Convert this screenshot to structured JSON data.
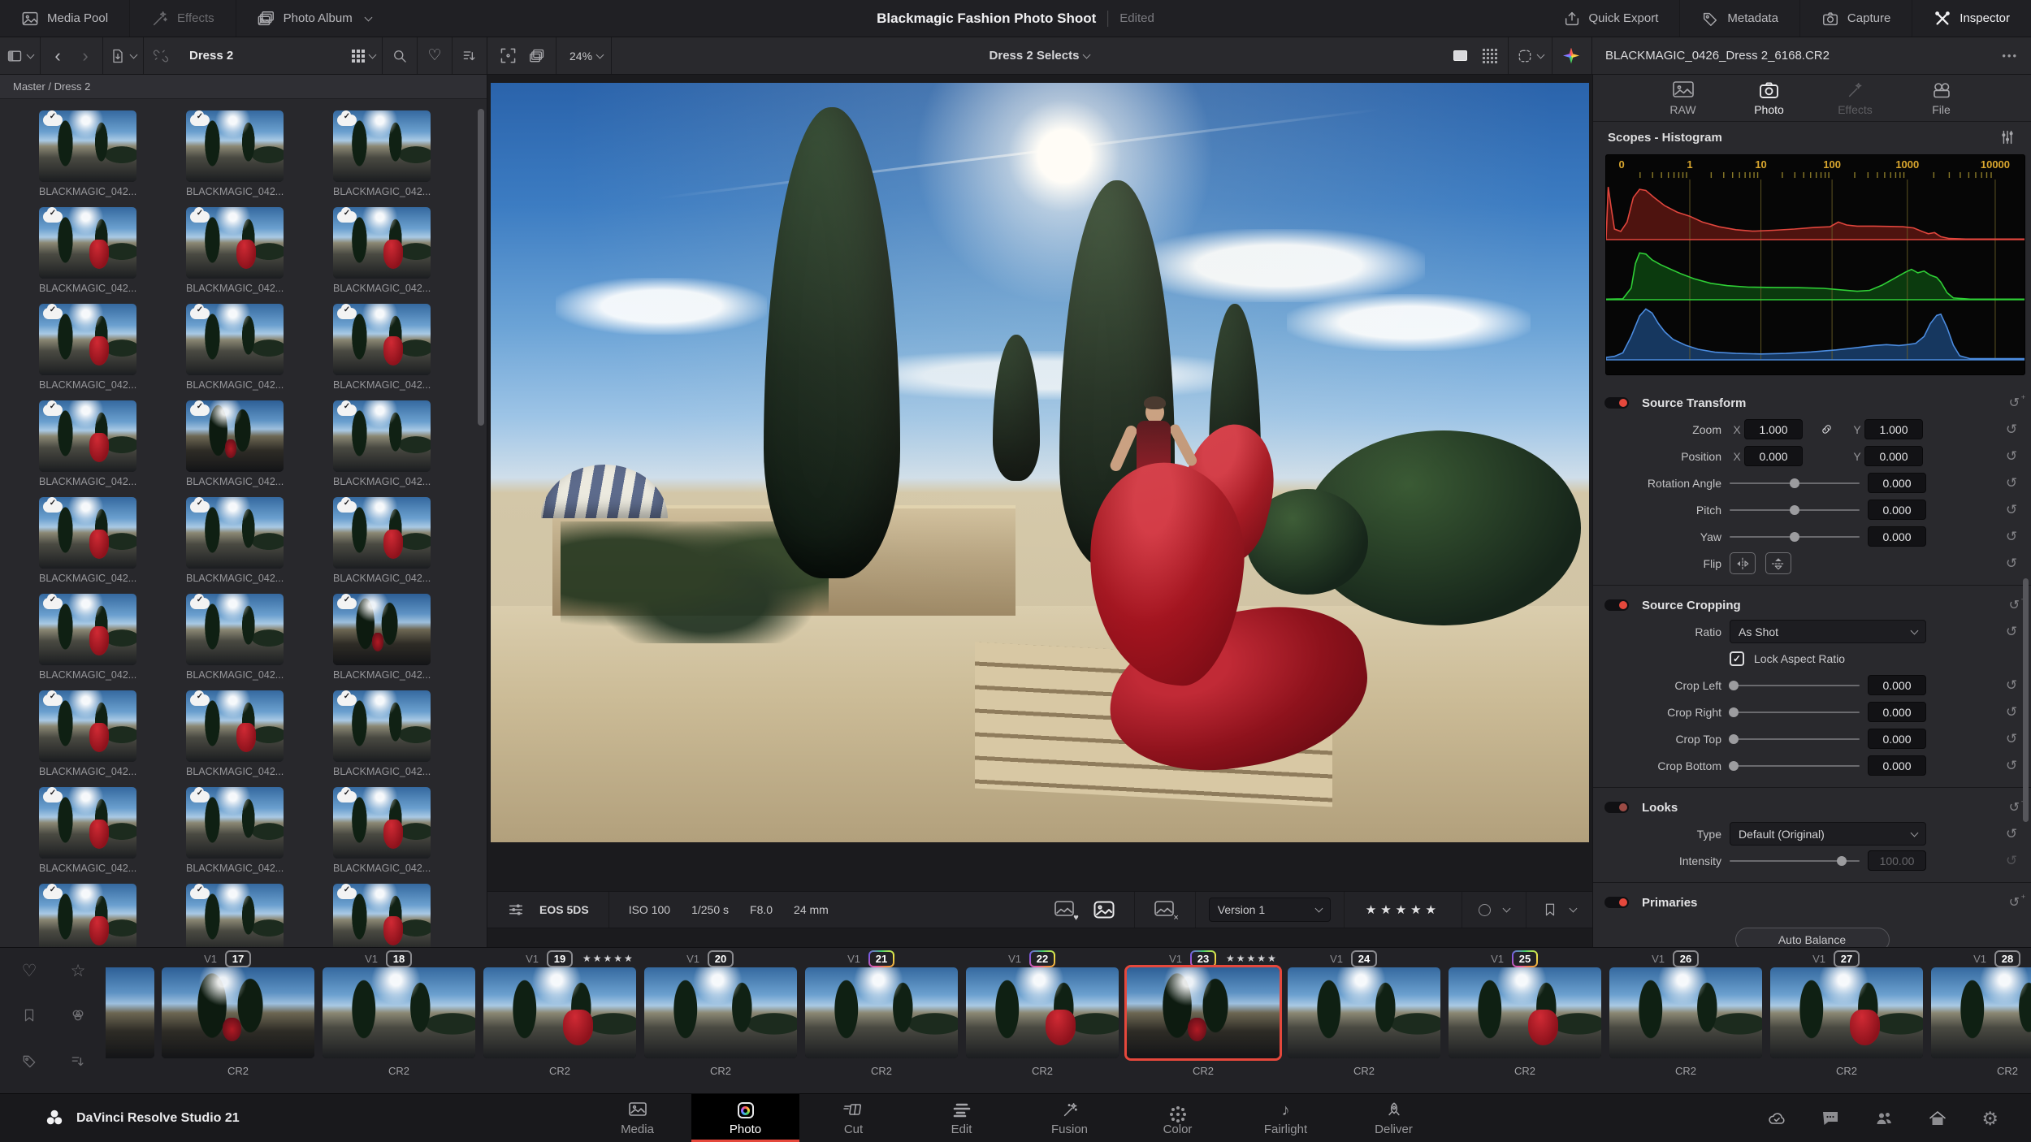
{
  "colors": {
    "accent": "#e5483c"
  },
  "icons": {
    "check": "✓",
    "reset": "↺",
    "plus": "+",
    "menu": "•••",
    "back": "‹",
    "forward": "›",
    "heart": "♡",
    "star": "☆",
    "note": "♪",
    "gear": "⚙",
    "heart_small": "♥",
    "x_small": "×"
  },
  "topbar": {
    "media_pool": "Media Pool",
    "effects": "Effects",
    "photo_album": "Photo Album",
    "title": "Blackmagic Fashion Photo Shoot",
    "edited": "Edited",
    "quick_export": "Quick Export",
    "metadata": "Metadata",
    "capture": "Capture",
    "inspector": "Inspector"
  },
  "browser": {
    "album_label": "Dress 2",
    "zoom_level": "24%",
    "breadcrumb": "Master / Dress 2",
    "items": [
      {
        "label": "BLACKMAGIC_042...",
        "variant": "a"
      },
      {
        "label": "BLACKMAGIC_042...",
        "variant": "a"
      },
      {
        "label": "BLACKMAGIC_042...",
        "variant": "a"
      },
      {
        "label": "BLACKMAGIC_042...",
        "variant": "b"
      },
      {
        "label": "BLACKMAGIC_042...",
        "variant": "b"
      },
      {
        "label": "BLACKMAGIC_042...",
        "variant": "b"
      },
      {
        "label": "BLACKMAGIC_042...",
        "variant": "b"
      },
      {
        "label": "BLACKMAGIC_042...",
        "variant": "a"
      },
      {
        "label": "BLACKMAGIC_042...",
        "variant": "b"
      },
      {
        "label": "BLACKMAGIC_042...",
        "variant": "b"
      },
      {
        "label": "BLACKMAGIC_042...",
        "variant": "c"
      },
      {
        "label": "BLACKMAGIC_042...",
        "variant": "a"
      },
      {
        "label": "BLACKMAGIC_042...",
        "variant": "b"
      },
      {
        "label": "BLACKMAGIC_042...",
        "variant": "a"
      },
      {
        "label": "BLACKMAGIC_042...",
        "variant": "b"
      },
      {
        "label": "BLACKMAGIC_042...",
        "variant": "b"
      },
      {
        "label": "BLACKMAGIC_042...",
        "variant": "a"
      },
      {
        "label": "BLACKMAGIC_042...",
        "variant": "c"
      },
      {
        "label": "BLACKMAGIC_042...",
        "variant": "b"
      },
      {
        "label": "BLACKMAGIC_042...",
        "variant": "b"
      },
      {
        "label": "BLACKMAGIC_042...",
        "variant": "a"
      },
      {
        "label": "BLACKMAGIC_042...",
        "variant": "b"
      },
      {
        "label": "BLACKMAGIC_042...",
        "variant": "a"
      },
      {
        "label": "BLACKMAGIC_042...",
        "variant": "b"
      },
      {
        "label": "BLACKMAGIC_042...",
        "variant": "b"
      },
      {
        "label": "BLACKMAGIC_042...",
        "variant": "a"
      },
      {
        "label": "BLACKMAGIC_042...",
        "variant": "b"
      }
    ]
  },
  "viewer": {
    "collection_label": "Dress 2 Selects"
  },
  "metadata_bar": {
    "camera": "EOS 5DS",
    "iso": "ISO 100",
    "shutter": "1/250 s",
    "aperture": "F8.0",
    "focal": "24 mm",
    "version": "Version 1",
    "rating": "★★★★★"
  },
  "inspector": {
    "filename": "BLACKMAGIC_0426_Dress 2_6168.CR2",
    "tabs": [
      {
        "label": "RAW"
      },
      {
        "label": "Photo"
      },
      {
        "label": "Effects"
      },
      {
        "label": "File"
      }
    ],
    "scopes_title": "Scopes - Histogram",
    "source_transform": {
      "title": "Source Transform",
      "zoom_label": "Zoom",
      "position_label": "Position",
      "x_label": "X",
      "y_label": "Y",
      "zoom_x": "1.000",
      "zoom_y": "1.000",
      "position_x": "0.000",
      "position_y": "0.000",
      "sliders": [
        {
          "label": "Rotation Angle",
          "value": "0.000"
        },
        {
          "label": "Pitch",
          "value": "0.000"
        },
        {
          "label": "Yaw",
          "value": "0.000"
        }
      ],
      "flip_label": "Flip"
    },
    "source_cropping": {
      "title": "Source Cropping",
      "ratio_label": "Ratio",
      "ratio_value": "As Shot",
      "lock_label": "Lock Aspect Ratio",
      "sliders": [
        {
          "label": "Crop Left",
          "value": "0.000"
        },
        {
          "label": "Crop Right",
          "value": "0.000"
        },
        {
          "label": "Crop Top",
          "value": "0.000"
        },
        {
          "label": "Crop Bottom",
          "value": "0.000"
        }
      ]
    },
    "looks": {
      "title": "Looks",
      "type_label": "Type",
      "type_value": "Default (Original)",
      "intensity_label": "Intensity",
      "intensity_value": "100.00"
    },
    "primaries": {
      "title": "Primaries",
      "auto_balance": "Auto Balance"
    }
  },
  "chart_data": {
    "type": "histogram",
    "title": "Scopes - Histogram",
    "scale": "log",
    "legend": "none",
    "grid": true,
    "axis": {
      "labels": [
        "0",
        "1",
        "10",
        "100",
        "1000",
        "10000"
      ],
      "x": [
        0.03,
        0.2,
        0.37,
        0.54,
        0.72,
        0.93
      ],
      "color": "#d9a62e",
      "tick_color": "#8a7a28",
      "grid_color": "#6d6128"
    },
    "series": [
      {
        "name": "red",
        "stroke": "#e0463d",
        "fill": "#4e130f",
        "points": [
          [
            0,
            0.02
          ],
          [
            0.005,
            0.9
          ],
          [
            0.012,
            0.55
          ],
          [
            0.02,
            0.18
          ],
          [
            0.035,
            0.14
          ],
          [
            0.05,
            0.3
          ],
          [
            0.065,
            0.72
          ],
          [
            0.08,
            0.86
          ],
          [
            0.095,
            0.84
          ],
          [
            0.115,
            0.72
          ],
          [
            0.14,
            0.58
          ],
          [
            0.17,
            0.47
          ],
          [
            0.2,
            0.4
          ],
          [
            0.23,
            0.3
          ],
          [
            0.27,
            0.22
          ],
          [
            0.31,
            0.17
          ],
          [
            0.35,
            0.145
          ],
          [
            0.4,
            0.16
          ],
          [
            0.45,
            0.18
          ],
          [
            0.5,
            0.21
          ],
          [
            0.535,
            0.22
          ],
          [
            0.555,
            0.3
          ],
          [
            0.575,
            0.25
          ],
          [
            0.6,
            0.23
          ],
          [
            0.64,
            0.23
          ],
          [
            0.68,
            0.225
          ],
          [
            0.71,
            0.22
          ],
          [
            0.735,
            0.2
          ],
          [
            0.755,
            0.14
          ],
          [
            0.77,
            0.1
          ],
          [
            0.785,
            0.12
          ],
          [
            0.8,
            0.05
          ],
          [
            0.82,
            0.02
          ],
          [
            0.86,
            0.01
          ],
          [
            1,
            0.01
          ]
        ]
      },
      {
        "name": "green",
        "stroke": "#2fcf36",
        "fill": "#0b3a0e",
        "points": [
          [
            0,
            0.01
          ],
          [
            0.04,
            0.015
          ],
          [
            0.06,
            0.2
          ],
          [
            0.07,
            0.62
          ],
          [
            0.08,
            0.8
          ],
          [
            0.095,
            0.78
          ],
          [
            0.11,
            0.68
          ],
          [
            0.13,
            0.6
          ],
          [
            0.155,
            0.52
          ],
          [
            0.18,
            0.44
          ],
          [
            0.21,
            0.36
          ],
          [
            0.25,
            0.28
          ],
          [
            0.29,
            0.24
          ],
          [
            0.34,
            0.215
          ],
          [
            0.4,
            0.21
          ],
          [
            0.46,
            0.205
          ],
          [
            0.52,
            0.195
          ],
          [
            0.56,
            0.17
          ],
          [
            0.6,
            0.145
          ],
          [
            0.63,
            0.16
          ],
          [
            0.66,
            0.25
          ],
          [
            0.69,
            0.37
          ],
          [
            0.715,
            0.47
          ],
          [
            0.73,
            0.52
          ],
          [
            0.745,
            0.46
          ],
          [
            0.76,
            0.49
          ],
          [
            0.775,
            0.42
          ],
          [
            0.79,
            0.38
          ],
          [
            0.8,
            0.3
          ],
          [
            0.815,
            0.12
          ],
          [
            0.83,
            0.03
          ],
          [
            0.87,
            0.01
          ],
          [
            1,
            0.01
          ]
        ]
      },
      {
        "name": "blue",
        "stroke": "#4b8bde",
        "fill": "#16375f",
        "points": [
          [
            0,
            0.04
          ],
          [
            0.02,
            0.06
          ],
          [
            0.04,
            0.12
          ],
          [
            0.06,
            0.4
          ],
          [
            0.08,
            0.75
          ],
          [
            0.095,
            0.87
          ],
          [
            0.11,
            0.8
          ],
          [
            0.125,
            0.62
          ],
          [
            0.14,
            0.48
          ],
          [
            0.16,
            0.35
          ],
          [
            0.19,
            0.25
          ],
          [
            0.22,
            0.18
          ],
          [
            0.26,
            0.13
          ],
          [
            0.31,
            0.11
          ],
          [
            0.37,
            0.1
          ],
          [
            0.43,
            0.11
          ],
          [
            0.49,
            0.135
          ],
          [
            0.55,
            0.17
          ],
          [
            0.6,
            0.21
          ],
          [
            0.64,
            0.245
          ],
          [
            0.67,
            0.26
          ],
          [
            0.7,
            0.245
          ],
          [
            0.72,
            0.26
          ],
          [
            0.74,
            0.28
          ],
          [
            0.76,
            0.4
          ],
          [
            0.775,
            0.62
          ],
          [
            0.79,
            0.76
          ],
          [
            0.8,
            0.78
          ],
          [
            0.815,
            0.55
          ],
          [
            0.83,
            0.25
          ],
          [
            0.845,
            0.07
          ],
          [
            0.87,
            0.02
          ],
          [
            1,
            0.02
          ]
        ]
      }
    ]
  },
  "filmstrip": {
    "version_label": "V1",
    "format_label": "CR2",
    "items": [
      {
        "num": "17",
        "variant": "c"
      },
      {
        "num": "18",
        "variant": "a"
      },
      {
        "num": "19",
        "variant": "b",
        "stars": "★★★★★"
      },
      {
        "num": "20",
        "variant": "a"
      },
      {
        "num": "21",
        "variant": "a",
        "multi": true
      },
      {
        "num": "22",
        "variant": "b",
        "multi": true
      },
      {
        "num": "23",
        "variant": "c",
        "multi": true,
        "stars": "★★★★★",
        "selected": true
      },
      {
        "num": "24",
        "variant": "a"
      },
      {
        "num": "25",
        "variant": "b",
        "multi": true
      },
      {
        "num": "26",
        "variant": "a"
      },
      {
        "num": "27",
        "variant": "b"
      },
      {
        "num": "28",
        "variant": "a"
      }
    ]
  },
  "appbar": {
    "product": "DaVinci Resolve Studio 21",
    "pages": [
      {
        "label": "Media"
      },
      {
        "label": "Photo",
        "active": true
      },
      {
        "label": "Cut"
      },
      {
        "label": "Edit"
      },
      {
        "label": "Fusion"
      },
      {
        "label": "Color"
      },
      {
        "label": "Fairlight"
      },
      {
        "label": "Deliver"
      }
    ]
  }
}
